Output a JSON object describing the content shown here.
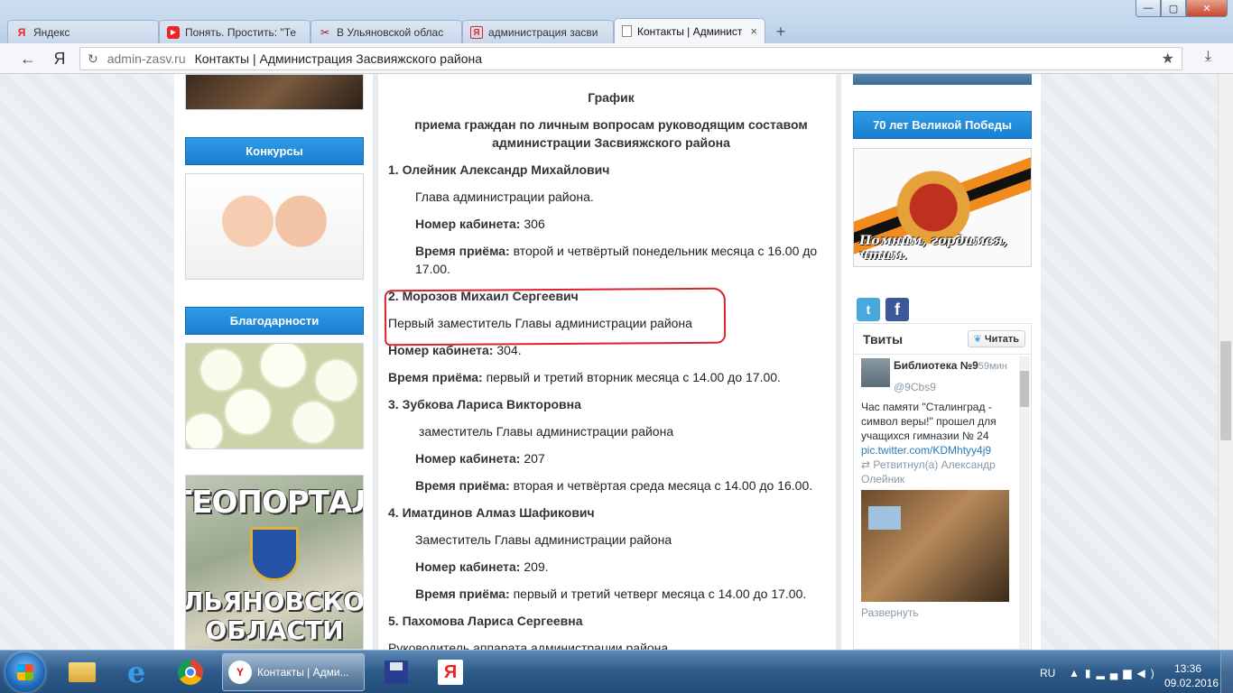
{
  "browser": {
    "tabs": [
      {
        "title": "Яндекс",
        "icon": "yandex-icon",
        "active": false
      },
      {
        "title": "Понять. Простить: \"Те",
        "icon": "youtube-icon",
        "active": false
      },
      {
        "title": "В Ульяновской облас",
        "icon": "news-icon",
        "active": false
      },
      {
        "title": "администрация засви",
        "icon": "yandex-icon",
        "active": false
      },
      {
        "title": "Контакты | Админист",
        "icon": "page-icon",
        "active": true
      }
    ],
    "tab_close_glyph": "×",
    "new_tab_glyph": "+",
    "ya_button": "Я",
    "address_domain": "admin-zasv.ru",
    "address_title": "Контакты | Администрация Засвияжского района",
    "window_buttons": {
      "minimize": "—",
      "maximize": "▢",
      "close": "✕"
    }
  },
  "left_column": {
    "contests_label": "Конкурсы",
    "thanks_label": "Благодарности",
    "geoportal_title": "ГЕОПОРТАЛ",
    "geoportal_sub1": "УЛЬЯНОВСКОЙ",
    "geoportal_sub2": "ОБЛАСТИ"
  },
  "schedule": {
    "title": "График",
    "subtitle1": "приема граждан по личным вопросам руководящим составом",
    "subtitle2": "администрации Засвияжского района",
    "label_room": "Номер кабинета:",
    "label_time": "Время приёма:",
    "p1": {
      "name": "1. Олейник Александр Михайлович",
      "position": "Глава администрации района.",
      "room": " 306",
      "time1": " второй и четвёртый понедельник месяца с 16.00 до",
      "time2": "17.00."
    },
    "p2": {
      "name": "2. Морозов Михаил Сергеевич",
      "position": "Первый заместитель Главы администрации района",
      "room": " 304.",
      "time": " первый и третий вторник месяца с 14.00 до 17.00."
    },
    "p3": {
      "name": "3. Зубкова Лариса Викторовна",
      "position": "заместитель Главы администрации района",
      "room": " 207",
      "time": " вторая и четвёртая среда месяца с 14.00 до 16.00."
    },
    "p4": {
      "name": "4. Иматдинов Алмаз Шафикович",
      "position": "Заместитель Главы администрации района",
      "room": " 209.",
      "time": " первый и третий четверг месяца с 14.00 до 17.00."
    },
    "p5": {
      "name": "5. Пахомова Лариса Сергеевна",
      "position": "Руководитель аппарата администрации района"
    }
  },
  "right_column": {
    "victory_label": "70 лет Великой Победы",
    "victory_caption": "Помним, гордимся, чтим."
  },
  "twitter": {
    "title": "Твиты",
    "follow_label": "Читать",
    "tweet": {
      "name": "Библиотека №9",
      "time": "59мин",
      "handle": "@9Cbs9",
      "text": "Час памяти \"Сталинград - символ веры!\" прошел для учащихся гимназии № 24",
      "link": "pic.twitter.com/KDMhtyy4j9",
      "retweet": "Ретвитнул(а) Александр Олейник",
      "expand": "Развернуть"
    }
  },
  "taskbar": {
    "active_app": "Контакты | Адми...",
    "lang": "RU",
    "time": "13:36",
    "date": "09.02.2016"
  }
}
